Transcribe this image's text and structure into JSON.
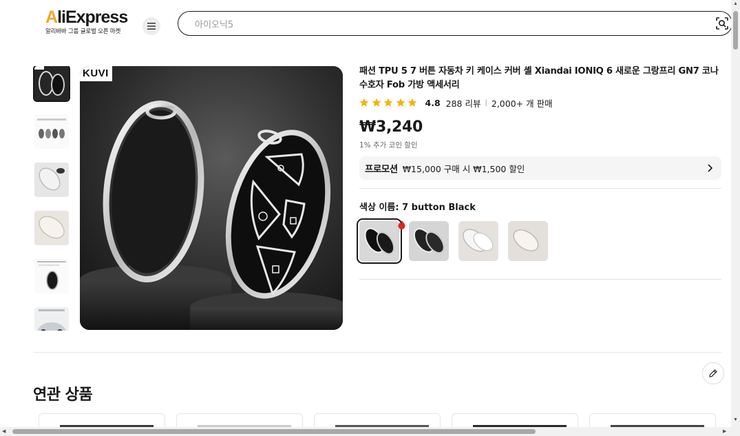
{
  "header": {
    "logo_main_a": "A",
    "logo_main_b": "liExpress",
    "logo_sub": "알리바바 그룹 글로벌 오픈 마켓",
    "search_placeholder": "아이오닉5"
  },
  "gallery": {
    "brand": "KUVI",
    "thumbnail_count": 6,
    "active_thumbnail": 1
  },
  "product": {
    "title": "패션 TPU 5 7 버튼 자동차 키 케이스 커버 셸 Xiandai IONIQ 6 새로운 그랑프리 GN7 코나 수호자 Fob 가방 액세서리",
    "rating": "4.8",
    "star_count": 5,
    "reviews": "288 리뷰",
    "separator": "|",
    "sold": "2,000+ 개 판매",
    "price": "₩3,240",
    "coin_note": "1% 추가 코인 할인",
    "promo_label": "프로모션",
    "promo_text": "₩15,000 구매 시 ₩1,500 할인",
    "color_label": "색상 이름: 7 button Black",
    "swatch_count": 4,
    "selected_swatch": 1
  },
  "related": {
    "title": "연관 상품"
  },
  "colors": {
    "text": "#191919",
    "star": "#f5b400",
    "hot": "#e4261c",
    "accent": "#f5a623"
  }
}
